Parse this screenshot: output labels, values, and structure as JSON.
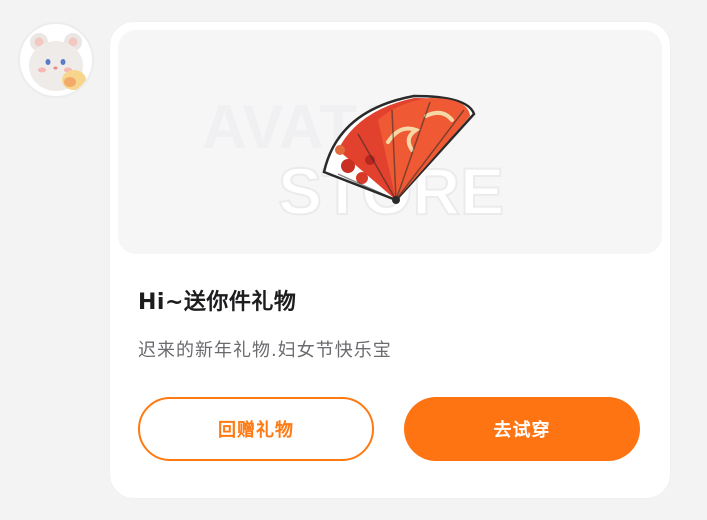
{
  "colors": {
    "accent": "#ff7412",
    "card_bg": "#ffffff",
    "page_bg": "#f3f3f4",
    "title_text": "#1d1d1f",
    "subtitle_text": "#6a6a6f"
  },
  "sender": {
    "avatar_icon": "bear-avatar-icon"
  },
  "gift_card": {
    "preview": {
      "watermark_line1": "AVATAR",
      "watermark_line2": "STORE",
      "item_icon": "folding-fan-icon"
    },
    "title": "Hi~送你件礼物",
    "message": "迟来的新年礼物.妇女节快乐宝",
    "return_gift_label": "回赠礼物",
    "try_on_label": "去试穿"
  }
}
